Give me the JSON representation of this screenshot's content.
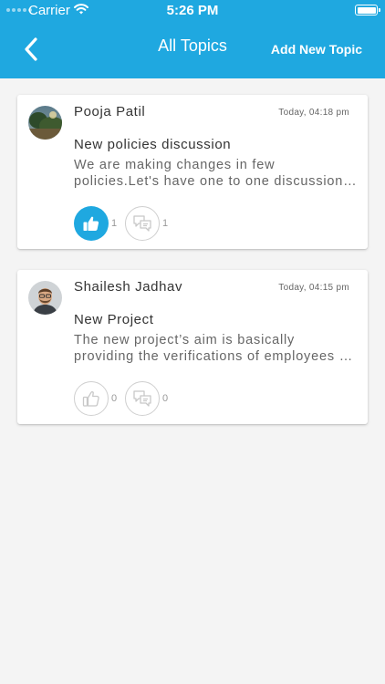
{
  "status_bar": {
    "carrier": "Carrier",
    "time": "5:26 PM"
  },
  "nav": {
    "title": "All Topics",
    "add_label": "Add New Topic"
  },
  "colors": {
    "accent": "#1fa8e0",
    "background": "#f4f4f4"
  },
  "topics": [
    {
      "author": "Pooja Patil",
      "timestamp": "Today, 04:18 pm",
      "title": "New policies discussion",
      "body_line1": "We are making changes in few",
      "body_line2": "policies.Let's have one to one discussion…",
      "likes": "1",
      "comments": "1",
      "liked": true
    },
    {
      "author": "Shailesh Jadhav",
      "timestamp": "Today, 04:15 pm",
      "title": "New Project",
      "body_line1": "The new project’s aim is basically",
      "body_line2": "providing the verifications of employees …",
      "likes": "0",
      "comments": "0",
      "liked": false
    }
  ]
}
